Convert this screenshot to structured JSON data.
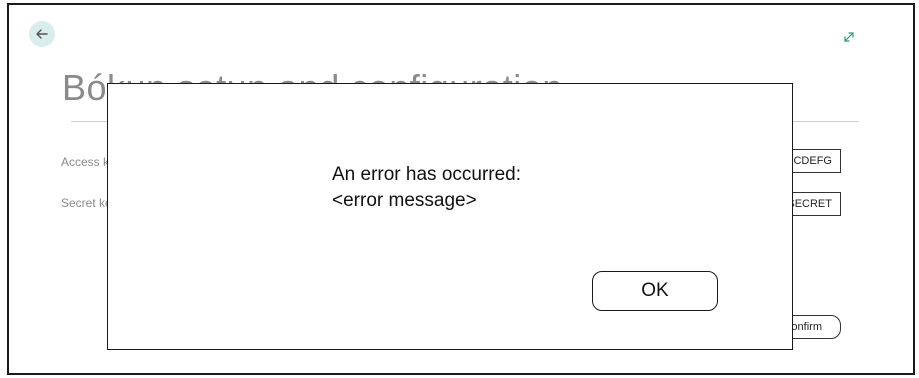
{
  "page": {
    "title": "Bókun setup and configuration"
  },
  "form": {
    "access_key_label": "Access key",
    "access_key_value": "ABCDEFG",
    "secret_key_label": "Secret key",
    "secret_key_value": "SECRET",
    "confirm_label": "Confirm"
  },
  "dialog": {
    "heading": "An error has occurred:",
    "message": "<error message>",
    "ok_label": "OK"
  },
  "icons": {
    "back": "arrow-left-icon",
    "expand": "expand-icon"
  },
  "colors": {
    "accent": "#d9eded",
    "muted_text": "#8a8a8a"
  }
}
